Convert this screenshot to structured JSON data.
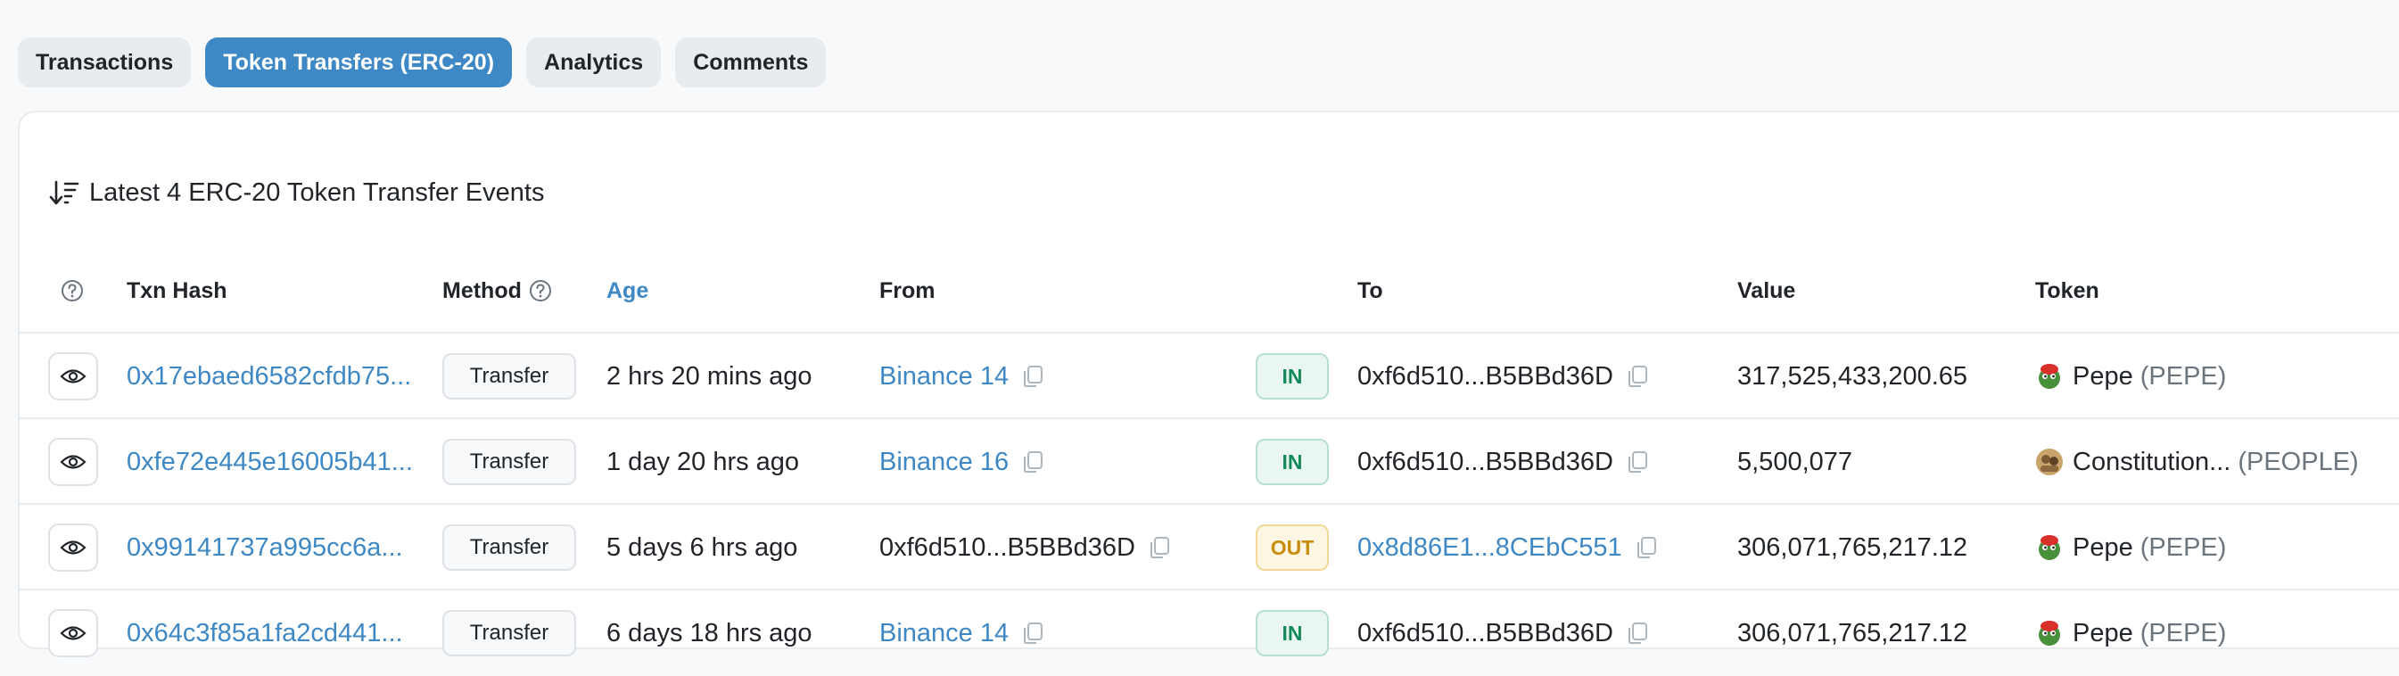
{
  "tabs": [
    {
      "label": "Transactions"
    },
    {
      "label": "Token Transfers (ERC-20)"
    },
    {
      "label": "Analytics"
    },
    {
      "label": "Comments"
    }
  ],
  "card": {
    "title": "Latest 4 ERC-20 Token Transfer Events"
  },
  "headers": {
    "txn_hash": "Txn Hash",
    "method": "Method",
    "age": "Age",
    "from": "From",
    "to": "To",
    "value": "Value",
    "token": "Token"
  },
  "rows": [
    {
      "hash": "0x17ebaed6582cfdb75...",
      "method": "Transfer",
      "age": "2 hrs 20 mins ago",
      "from": "Binance 14",
      "direction": "IN",
      "to": "0xf6d510...B5BBd36D",
      "value": "317,525,433,200.65",
      "token_name": "Pepe",
      "token_symbol": "(PEPE)"
    },
    {
      "hash": "0xfe72e445e16005b41...",
      "method": "Transfer",
      "age": "1 day 20 hrs ago",
      "from": "Binance 16",
      "direction": "IN",
      "to": "0xf6d510...B5BBd36D",
      "value": "5,500,077",
      "token_name": "Constitution...",
      "token_symbol": "(PEOPLE)"
    },
    {
      "hash": "0x99141737a995cc6a...",
      "method": "Transfer",
      "age": "5 days 6 hrs ago",
      "from": "0xf6d510...B5BBd36D",
      "direction": "OUT",
      "to": "0x8d86E1...8CEbC551",
      "value": "306,071,765,217.12",
      "token_name": "Pepe",
      "token_symbol": "(PEPE)"
    },
    {
      "hash": "0x64c3f85a1fa2cd441...",
      "method": "Transfer",
      "age": "6 days 18 hrs ago",
      "from": "Binance 14",
      "direction": "IN",
      "to": "0xf6d510...B5BBd36D",
      "value": "306,071,765,217.12",
      "token_name": "Pepe",
      "token_symbol": "(PEPE)"
    }
  ],
  "colors": {
    "accent": "#3d88c5",
    "in_badge": "#158a5c",
    "out_badge": "#c98d0e"
  },
  "icons": [
    "sort-icon",
    "question-icon",
    "eye-icon",
    "copy-icon",
    "pepe-token-icon",
    "people-token-icon"
  ]
}
